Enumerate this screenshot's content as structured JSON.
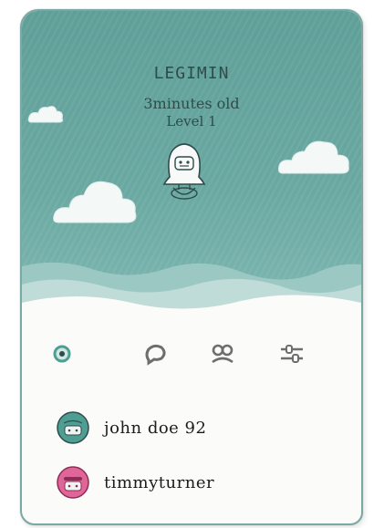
{
  "pet": {
    "name": "LEGIMIN",
    "age": "3minutes old",
    "level": "Level 1"
  },
  "actions": [
    {
      "icon": "home-dot-icon"
    },
    {
      "icon": "chat-bubble-icon"
    },
    {
      "icon": "group-icon"
    },
    {
      "icon": "settings-sliders-icon"
    }
  ],
  "friends": [
    {
      "username": "john doe 92",
      "avatar_color": "#4e9e94"
    },
    {
      "username": "timmyturner",
      "avatar_color": "#e0669a"
    }
  ],
  "colors": {
    "sky": "#6aa9a2",
    "accent": "#4e9e94",
    "pink": "#e0669a"
  }
}
